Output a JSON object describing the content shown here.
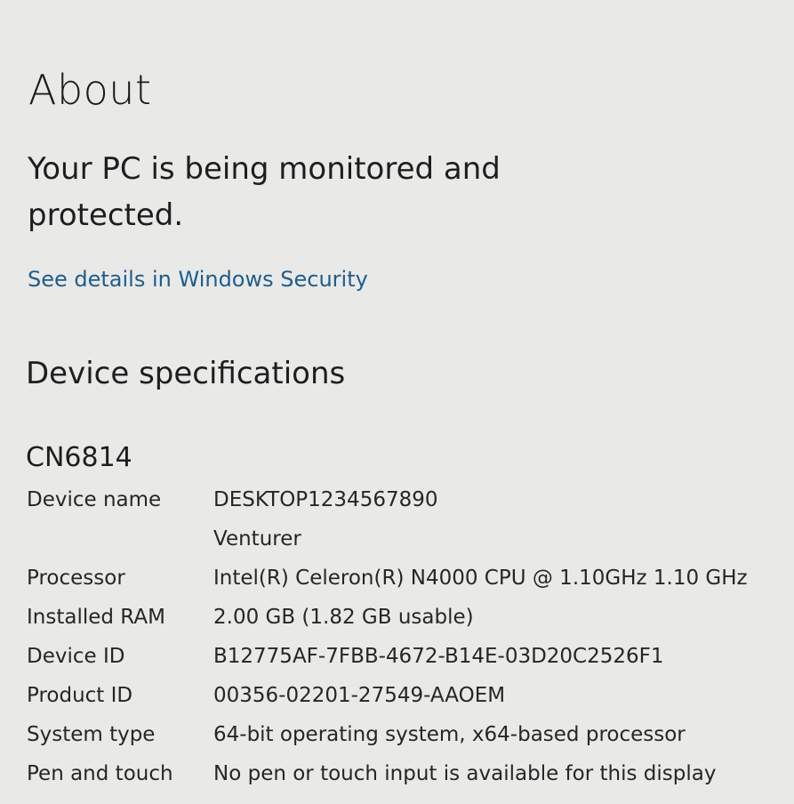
{
  "page": {
    "title": "About"
  },
  "security": {
    "status": "Your PC is being monitored and protected.",
    "link": "See details in Windows Security"
  },
  "device_specs": {
    "heading": "Device specifications",
    "model": "CN6814",
    "rows": [
      {
        "label": "Device name",
        "value": "DESKTOP1234567890",
        "value2": "Venturer"
      },
      {
        "label": "Processor",
        "value": "Intel(R) Celeron(R) N4000 CPU @ 1.10GHz   1.10 GHz"
      },
      {
        "label": "Installed RAM",
        "value": "2.00 GB (1.82 GB usable)"
      },
      {
        "label": "Device ID",
        "value": "B12775AF-7FBB-4672-B14E-03D20C2526F1"
      },
      {
        "label": "Product ID",
        "value": "00356-02201-27549-AAOEM"
      },
      {
        "label": "System type",
        "value": "64-bit operating system, x64-based processor"
      },
      {
        "label": "Pen and touch",
        "value": "No pen or touch input is available for this display"
      }
    ]
  },
  "colors": {
    "background": "#e9e9e7",
    "link": "#1e5d8f",
    "text": "#1e1e1e"
  }
}
